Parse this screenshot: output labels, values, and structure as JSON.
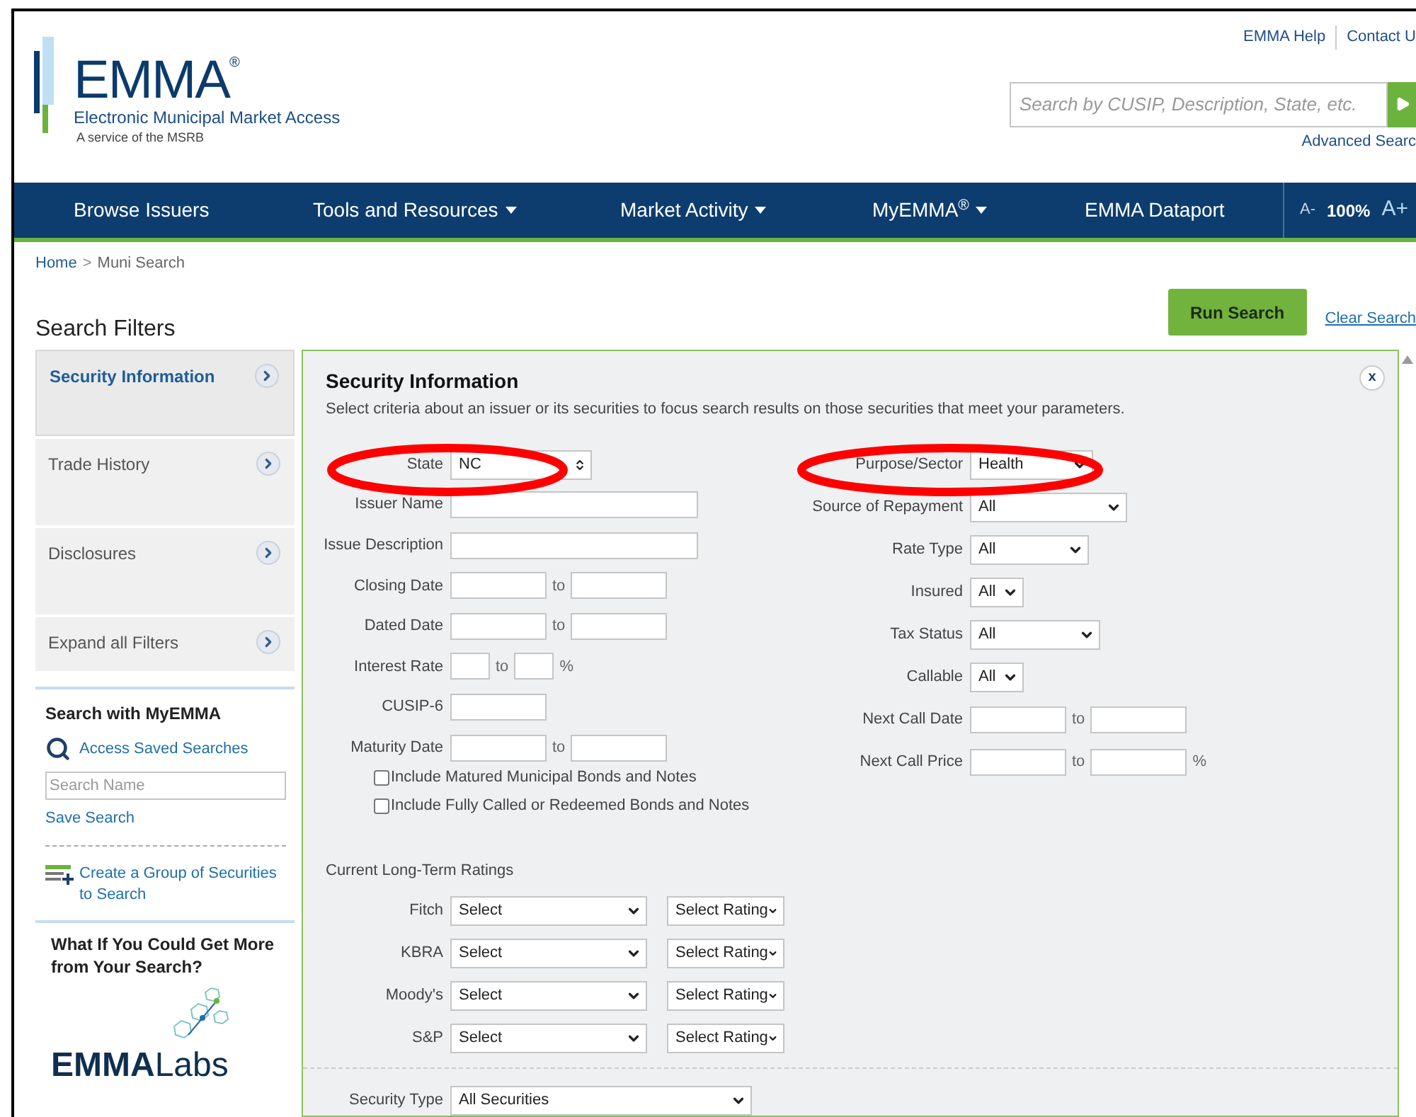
{
  "header": {
    "logo_title": "EMMA",
    "logo_mark": "®",
    "logo_subtitle": "Electronic Municipal Market Access",
    "logo_tagline": "A service of the MSRB",
    "top_links": [
      "EMMA Help",
      "Contact U"
    ],
    "search": {
      "placeholder": "Search by CUSIP, Description, State, etc."
    },
    "advanced_link": "Advanced Searc"
  },
  "nav": {
    "items": [
      {
        "label": "Browse Issuers",
        "dropdown": false
      },
      {
        "label": "Tools and Resources",
        "dropdown": true
      },
      {
        "label": "Market Activity",
        "dropdown": true
      },
      {
        "label": "MyEMMA$^{®}$",
        "dropdown": true
      },
      {
        "label": "EMMA Dataport",
        "dropdown": false
      }
    ],
    "font_controls": [
      "A-",
      "100%",
      "A+"
    ]
  },
  "breadcrumb": {
    "items": [
      "Home",
      "Muni Search"
    ],
    "separator": ">"
  },
  "page_title": "Search Filters",
  "run_search": "Run Search",
  "clear_search": "Clear Search",
  "sidebar": {
    "tabs": [
      {
        "label": "Security Information",
        "selected": true
      },
      {
        "label": "Trade History",
        "selected": false
      },
      {
        "label": "Disclosures",
        "selected": false
      },
      {
        "label": "Expand all Filters",
        "selected": false
      }
    ],
    "myemma": {
      "title": "Search with MyEMMA",
      "access_saved": "Access Saved Searches",
      "search_name": {
        "placeholder": "Search Name"
      },
      "save": "Save Search",
      "create_group": "Create a Group of Securities to Search"
    },
    "promo": {
      "title": "What If You Could Get More from Your Search?",
      "logo_bold": "EMMA",
      "logo_light": "Labs"
    }
  },
  "panel": {
    "title": "Security Information",
    "description": "Select criteria about an issuer or its securities to focus search results on those securities that meet your parameters.",
    "close": "x",
    "left_fields": [
      {
        "label": "State",
        "kind": "spinner",
        "value": "NC"
      },
      {
        "label": "Issuer Name",
        "kind": "text"
      },
      {
        "label": "Issue Description",
        "kind": "text"
      },
      {
        "label": "Closing Date",
        "kind": "range",
        "separator": "to"
      },
      {
        "label": "Dated Date",
        "kind": "range",
        "separator": "to"
      },
      {
        "label": "Interest Rate",
        "kind": "range",
        "separator": "to",
        "suffix": "%"
      },
      {
        "label": "CUSIP-6",
        "kind": "text"
      },
      {
        "label": "Maturity Date",
        "kind": "range",
        "separator": "to"
      }
    ],
    "checkboxes": [
      {
        "label": "Include Matured Municipal Bonds and Notes",
        "checked": false
      },
      {
        "label": "Include Fully Called or Redeemed Bonds and Notes",
        "checked": false
      }
    ],
    "right_fields": [
      {
        "label": "Purpose/Sector",
        "kind": "select",
        "value": "Health"
      },
      {
        "label": "Source of Repayment",
        "kind": "select",
        "value": "All"
      },
      {
        "label": "Rate Type",
        "kind": "select",
        "value": "All"
      },
      {
        "label": "Insured",
        "kind": "select",
        "value": "All"
      },
      {
        "label": "Tax Status",
        "kind": "select",
        "value": "All"
      },
      {
        "label": "Callable",
        "kind": "select",
        "value": "All"
      },
      {
        "label": "Next Call Date",
        "kind": "range",
        "separator": "to"
      },
      {
        "label": "Next Call Price",
        "kind": "range",
        "separator": "to",
        "suffix": "%"
      }
    ],
    "ratings_title": "Current Long-Term Ratings",
    "ratings": [
      {
        "agency": "Fitch",
        "value": "Select",
        "rating": "Select Rating"
      },
      {
        "agency": "KBRA",
        "value": "Select",
        "rating": "Select Rating"
      },
      {
        "agency": "Moody's",
        "value": "Select",
        "rating": "Select Rating"
      },
      {
        "agency": "S&P",
        "value": "Select",
        "rating": "Select Rating"
      }
    ],
    "security_type": {
      "label": "Security Type",
      "value": "All Securities"
    }
  }
}
